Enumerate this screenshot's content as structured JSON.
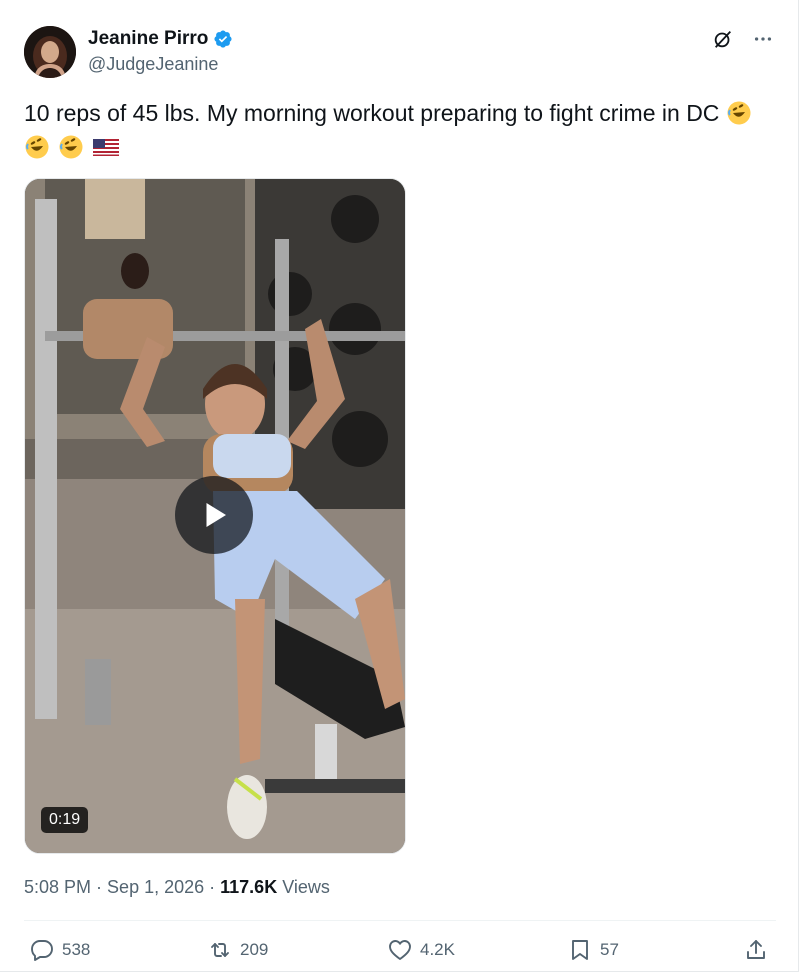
{
  "author": {
    "display_name": "Jeanine Pirro",
    "handle": "@JudgeJeanine",
    "verified": true
  },
  "tweet": {
    "text": "10 reps of 45 lbs. My morning workout preparing to fight crime in DC",
    "emojis": [
      "rolling-on-floor-laughing",
      "rolling-on-floor-laughing",
      "rolling-on-floor-laughing",
      "us-flag"
    ]
  },
  "media": {
    "type": "video",
    "duration": "0:19"
  },
  "meta": {
    "time": "5:08 PM",
    "separator": " · ",
    "date": "Sep 1, 2026",
    "views_count": "117.6K",
    "views_label": "Views"
  },
  "actions": {
    "replies": "538",
    "reposts": "209",
    "likes": "4.2K",
    "bookmarks": "57"
  },
  "colors": {
    "text_primary": "#0f1419",
    "text_secondary": "#536471",
    "verified_blue": "#1d9bf0",
    "divider": "#eff3f4"
  }
}
